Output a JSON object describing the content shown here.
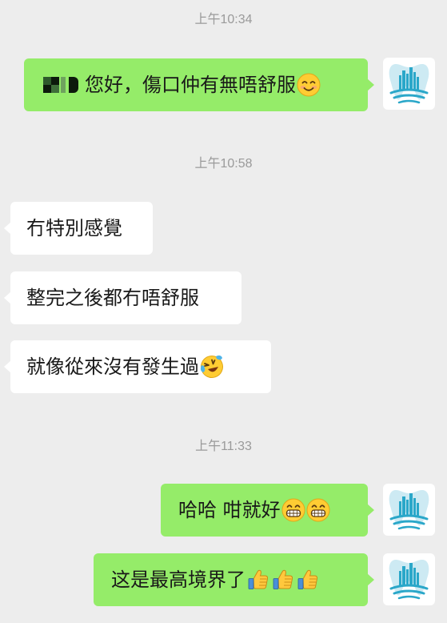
{
  "conversation": {
    "timestamps": [
      "上午10:34",
      "上午10:58",
      "上午11:33"
    ],
    "messages": [
      {
        "side": "out",
        "text": "您好，傷口仲有無唔舒服",
        "emojis": [
          "smiling-face-icon"
        ],
        "redacted_prefix": true
      },
      {
        "side": "in",
        "text": "冇特別感覺",
        "emojis": []
      },
      {
        "side": "in",
        "text": "整完之後都冇唔舒服",
        "emojis": []
      },
      {
        "side": "in",
        "text": "就像從來沒有發生過",
        "emojis": [
          "laughing-tears-face-icon"
        ]
      },
      {
        "side": "out",
        "text": "哈哈 咁就好",
        "emojis": [
          "grinning-face-icon",
          "grinning-face-icon"
        ]
      },
      {
        "side": "out",
        "text": "这是最高境界了",
        "emojis": [
          "thumbs-up-icon",
          "thumbs-up-icon",
          "thumbs-up-icon"
        ]
      }
    ]
  },
  "colors": {
    "background": "#ededed",
    "outgoing_bubble": "#95ec69",
    "incoming_bubble": "#ffffff",
    "timestamp_text": "#9a9a9a",
    "avatar_brand": "#2aa7c9"
  },
  "avatar": {
    "icon": "dental-clinic-logo-icon"
  }
}
